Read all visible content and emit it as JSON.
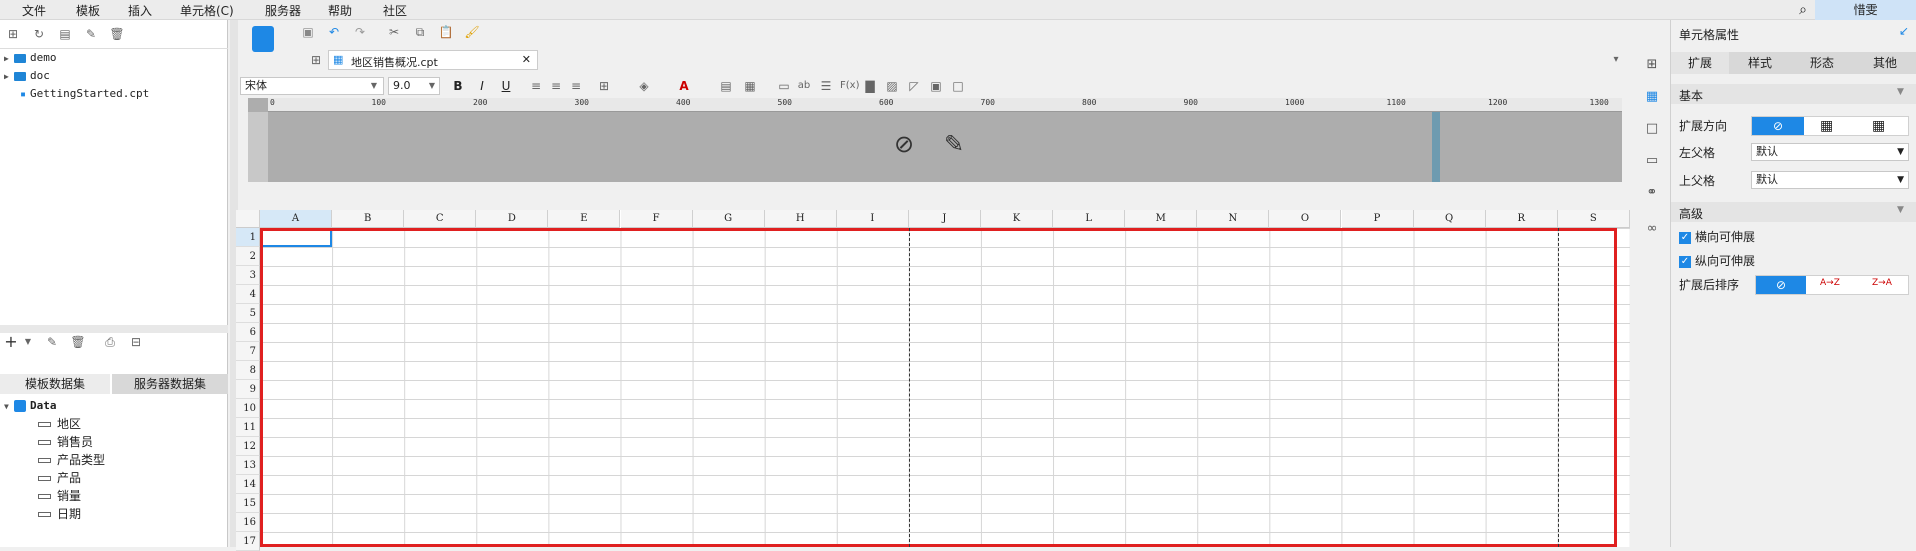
{
  "menu": [
    "文件",
    "模板",
    "插入",
    "单元格(C)",
    "服务器",
    "帮助",
    "社区"
  ],
  "user": "惜雯",
  "tree": [
    {
      "label": "demo",
      "type": "folder"
    },
    {
      "label": "doc",
      "type": "folder"
    },
    {
      "label": "GettingStarted.cpt",
      "type": "file"
    }
  ],
  "dataset_tabs": [
    "模板数据集",
    "服务器数据集"
  ],
  "dataset": {
    "name": "Data",
    "fields": [
      "地区",
      "销售员",
      "产品类型",
      "产品",
      "销量",
      "日期"
    ]
  },
  "doc_tab": "地区销售概况.cpt",
  "font": {
    "name": "宋体",
    "size": "9.0"
  },
  "ruler_ticks": [
    "0",
    "100",
    "200",
    "300",
    "400",
    "500",
    "600",
    "700",
    "800",
    "900",
    "1000",
    "1100",
    "1200",
    "1300"
  ],
  "columns": [
    "A",
    "B",
    "C",
    "D",
    "E",
    "F",
    "G",
    "H",
    "I",
    "J",
    "K",
    "L",
    "M",
    "N",
    "O",
    "P",
    "Q",
    "R",
    "S"
  ],
  "rows": [
    "1",
    "2",
    "3",
    "4",
    "5",
    "6",
    "7",
    "8",
    "9",
    "10",
    "11",
    "12",
    "13",
    "14",
    "15",
    "16",
    "17"
  ],
  "right_panel": {
    "title": "单元格属性",
    "tabs": [
      "扩展",
      "样式",
      "形态",
      "其他"
    ],
    "section_basic": "基本",
    "expand_dir": "扩展方向",
    "left_parent": "左父格",
    "left_parent_value": "默认",
    "upper_parent": "上父格",
    "upper_parent_value": "默认",
    "section_advanced": "高级",
    "h_expand": "横向可伸展",
    "v_expand": "纵向可伸展",
    "sort_after": "扩展后排序",
    "sort_options": [
      "A→Z",
      "Z→A"
    ]
  }
}
